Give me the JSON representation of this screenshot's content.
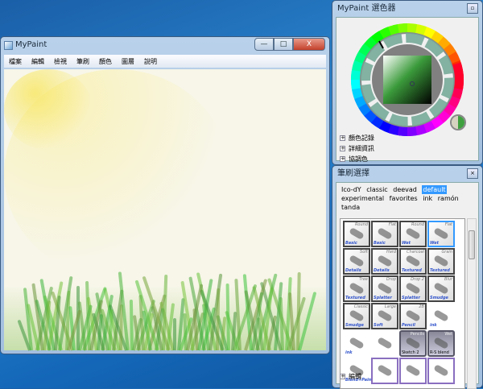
{
  "main_window": {
    "title": "MyPaint",
    "controls": [
      "—",
      "□",
      "X"
    ],
    "menu": [
      "檔案",
      "編輯",
      "檢視",
      "筆刷",
      "顏色",
      "圖層",
      "說明"
    ]
  },
  "color_panel": {
    "title": "MyPaint 選色器",
    "expanders": [
      "顏色記錄",
      "詳細資訊",
      "協調色"
    ],
    "current_color": "#3fa040",
    "previous_color": "#d6d3c0"
  },
  "brush_panel": {
    "title": "筆刷選擇",
    "groups": [
      "Ico-dY",
      "classic",
      "deevad",
      "default",
      "experimental",
      "favorites",
      "ink",
      "ramón",
      "tanda"
    ],
    "selected_group": "default",
    "brushes": [
      {
        "name": "Round",
        "group": "Basic",
        "style": "std"
      },
      {
        "name": "Flat",
        "group": "Basic",
        "style": "std"
      },
      {
        "name": "Round",
        "group": "Wet",
        "style": "std"
      },
      {
        "name": "Flat",
        "group": "Wet",
        "style": "std",
        "selected": true
      },
      {
        "name": "Soft",
        "group": "Details",
        "style": "std"
      },
      {
        "name": "Hard",
        "group": "Details",
        "style": "std"
      },
      {
        "name": "Charcoal",
        "group": "Textured",
        "style": "std"
      },
      {
        "name": "Grain",
        "group": "Textured",
        "style": "std"
      },
      {
        "name": "Tree",
        "group": "Textured",
        "style": "std"
      },
      {
        "name": "Drop",
        "group": "Splatter",
        "style": "std"
      },
      {
        "name": "Drop 2",
        "group": "Splatter",
        "style": "std"
      },
      {
        "name": "Blur",
        "group": "Smudge",
        "style": "std"
      },
      {
        "name": "Classic",
        "group": "Smudge",
        "style": "std"
      },
      {
        "name": "Large",
        "group": "Soft",
        "style": "std"
      },
      {
        "name": "2B",
        "group": "Pencil",
        "style": "std"
      },
      {
        "name": "",
        "group": "ink",
        "style": "plain"
      },
      {
        "name": "",
        "group": "ink",
        "style": "plain"
      },
      {
        "name": "",
        "group": "",
        "style": "plain"
      },
      {
        "name": "Pencils",
        "group": "Sketch 2",
        "style": "dark"
      },
      {
        "name": "Wet",
        "group": "R-S blend",
        "style": "dark"
      },
      {
        "name": "",
        "group": "Blend+Paint",
        "style": "plain"
      },
      {
        "name": "",
        "group": "",
        "style": "purple"
      },
      {
        "name": "",
        "group": "",
        "style": "purple"
      },
      {
        "name": "",
        "group": "",
        "style": "purple"
      }
    ],
    "footer": "編輯"
  }
}
